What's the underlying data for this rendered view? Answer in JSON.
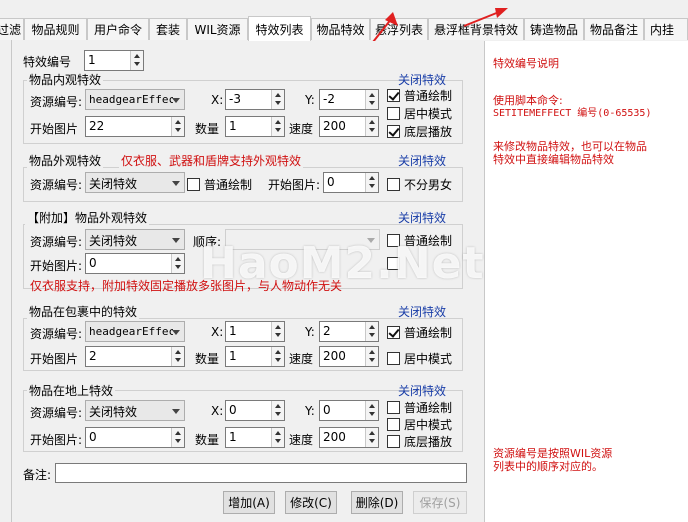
{
  "tabs": [
    "过滤",
    "物品规则",
    "用户命令",
    "套装",
    "WIL资源",
    "特效列表",
    "物品特效",
    "悬浮列表",
    "悬浮框背景特效",
    "铸造物品",
    "物品备注",
    "内挂"
  ],
  "active_tab": "特效列表",
  "effect_no": {
    "label": "特效编号",
    "value": "1"
  },
  "colors": {
    "red": "#d01010",
    "link": "#1a3ea8"
  },
  "inner": {
    "title": "物品内观特效",
    "close": "关闭特效",
    "res_label": "资源编号:",
    "res_value": "headgearEffect",
    "x_label": "X:",
    "x_value": "-3",
    "y_label": "Y:",
    "y_value": "-2",
    "start_label": "开始图片",
    "start_value": "22",
    "count_label": "数量",
    "count_value": "1",
    "speed_label": "速度",
    "speed_value": "200",
    "cb_normal": "普通绘制",
    "cb_center": "居中模式",
    "cb_bottom": "底层播放"
  },
  "outer": {
    "title": "物品外观特效",
    "note": "仅衣服、武器和盾牌支持外观特效",
    "close": "关闭特效",
    "res_label": "资源编号:",
    "res_value": "关闭特效",
    "cb_normal": "普通绘制",
    "start_label": "开始图片:",
    "start_value": "0",
    "cb_gender": "不分男女"
  },
  "extra": {
    "title": "【附加】物品外观特效",
    "close": "关闭特效",
    "res_label": "资源编号:",
    "res_value": "关闭特效",
    "order_label": "顺序:",
    "cb_normal": "普通绘制",
    "start_label": "开始图片:",
    "start_value": "0",
    "note": "仅衣服支持，附加特效固定播放多张图片，与人物动作无关"
  },
  "bag": {
    "title": "物品在包裹中的特效",
    "close": "关闭特效",
    "res_label": "资源编号:",
    "res_value": "headgearEffect",
    "x_label": "X:",
    "x_value": "1",
    "y_label": "Y:",
    "y_value": "2",
    "start_label": "开始图片",
    "start_value": "2",
    "count_label": "数量",
    "count_value": "1",
    "speed_label": "速度",
    "speed_value": "200",
    "cb_normal": "普通绘制",
    "cb_center": "居中模式"
  },
  "ground": {
    "title": "物品在地上特效",
    "close": "关闭特效",
    "res_label": "资源编号:",
    "res_value": "关闭特效",
    "x_label": "X:",
    "x_value": "0",
    "y_label": "Y:",
    "y_value": "0",
    "start_label": "开始图片:",
    "start_value": "0",
    "count_label": "数量",
    "count_value": "1",
    "speed_label": "速度",
    "speed_value": "200",
    "cb_normal": "普通绘制",
    "cb_center": "居中模式",
    "cb_bottom": "底层播放"
  },
  "remark": {
    "label": "备注:",
    "value": ""
  },
  "buttons": {
    "add": "增加(A)",
    "edit": "修改(C)",
    "del": "删除(D)",
    "save": "保存(S)"
  },
  "right_notes": {
    "title": "特效编号说明",
    "cmd_line1": "使用脚本命令:",
    "cmd_line2": "SETITEMEFFECT 编号(0-65535)",
    "tip_line1": "来修改物品特效，也可以在物品",
    "tip_line2": "特效中直接编辑物品特效",
    "foot_line1": "资源编号是按照WIL资源",
    "foot_line2": "列表中的顺序对应的。"
  },
  "watermark": "HaoM2.Net"
}
